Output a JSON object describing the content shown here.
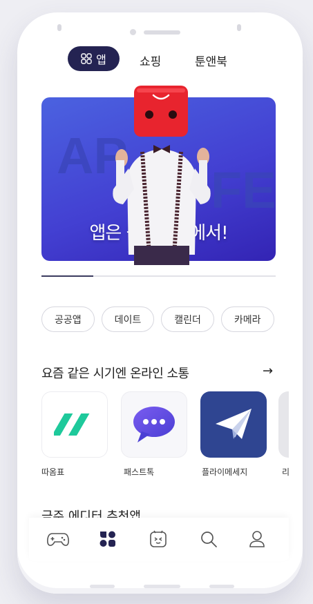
{
  "tabs": {
    "apps": "앱",
    "shopping": "쇼핑",
    "toons_books": "툰앤북"
  },
  "banner": {
    "caption": "앱은 원스토어에서!",
    "bg_word_left": "AP",
    "bg_word_right": "FE",
    "slide_progress": 0.22
  },
  "chips": [
    "공공앱",
    "데이트",
    "캘린더",
    "카메라"
  ],
  "section": {
    "title": "요즘 같은 시기엔 온라인 소통",
    "arrow": "→",
    "apps": [
      {
        "name": "따옴표",
        "icon": "quote-icon"
      },
      {
        "name": "패스트톡",
        "icon": "chat-bubble-icon"
      },
      {
        "name": "플라이메세지",
        "icon": "paper-plane-icon"
      },
      {
        "name": "리",
        "icon": "partial-app-icon"
      }
    ]
  },
  "section2": {
    "title": "금주 에디터 추천앱"
  },
  "bottom_nav": [
    "game-controller-icon",
    "apps-grid-icon",
    "toon-face-icon",
    "search-icon",
    "profile-icon"
  ],
  "colors": {
    "accent": "#242352",
    "banner": "#4541d3",
    "quote_green": "#1ec99b",
    "chat_purple": "#5a4ce0",
    "plane_blue": "#2f4591"
  }
}
